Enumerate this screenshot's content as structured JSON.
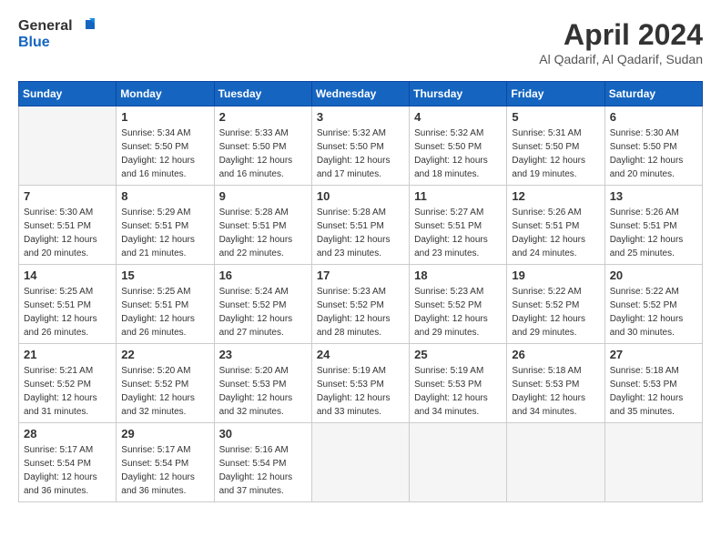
{
  "header": {
    "logo_general": "General",
    "logo_blue": "Blue",
    "title": "April 2024",
    "location": "Al Qadarif, Al Qadarif, Sudan"
  },
  "weekdays": [
    "Sunday",
    "Monday",
    "Tuesday",
    "Wednesday",
    "Thursday",
    "Friday",
    "Saturday"
  ],
  "weeks": [
    [
      {
        "day": null
      },
      {
        "day": "1",
        "sunrise": "5:34 AM",
        "sunset": "5:50 PM",
        "daylight": "12 hours and 16 minutes."
      },
      {
        "day": "2",
        "sunrise": "5:33 AM",
        "sunset": "5:50 PM",
        "daylight": "12 hours and 16 minutes."
      },
      {
        "day": "3",
        "sunrise": "5:32 AM",
        "sunset": "5:50 PM",
        "daylight": "12 hours and 17 minutes."
      },
      {
        "day": "4",
        "sunrise": "5:32 AM",
        "sunset": "5:50 PM",
        "daylight": "12 hours and 18 minutes."
      },
      {
        "day": "5",
        "sunrise": "5:31 AM",
        "sunset": "5:50 PM",
        "daylight": "12 hours and 19 minutes."
      },
      {
        "day": "6",
        "sunrise": "5:30 AM",
        "sunset": "5:50 PM",
        "daylight": "12 hours and 20 minutes."
      }
    ],
    [
      {
        "day": "7",
        "sunrise": "5:30 AM",
        "sunset": "5:51 PM",
        "daylight": "12 hours and 20 minutes."
      },
      {
        "day": "8",
        "sunrise": "5:29 AM",
        "sunset": "5:51 PM",
        "daylight": "12 hours and 21 minutes."
      },
      {
        "day": "9",
        "sunrise": "5:28 AM",
        "sunset": "5:51 PM",
        "daylight": "12 hours and 22 minutes."
      },
      {
        "day": "10",
        "sunrise": "5:28 AM",
        "sunset": "5:51 PM",
        "daylight": "12 hours and 23 minutes."
      },
      {
        "day": "11",
        "sunrise": "5:27 AM",
        "sunset": "5:51 PM",
        "daylight": "12 hours and 23 minutes."
      },
      {
        "day": "12",
        "sunrise": "5:26 AM",
        "sunset": "5:51 PM",
        "daylight": "12 hours and 24 minutes."
      },
      {
        "day": "13",
        "sunrise": "5:26 AM",
        "sunset": "5:51 PM",
        "daylight": "12 hours and 25 minutes."
      }
    ],
    [
      {
        "day": "14",
        "sunrise": "5:25 AM",
        "sunset": "5:51 PM",
        "daylight": "12 hours and 26 minutes."
      },
      {
        "day": "15",
        "sunrise": "5:25 AM",
        "sunset": "5:51 PM",
        "daylight": "12 hours and 26 minutes."
      },
      {
        "day": "16",
        "sunrise": "5:24 AM",
        "sunset": "5:52 PM",
        "daylight": "12 hours and 27 minutes."
      },
      {
        "day": "17",
        "sunrise": "5:23 AM",
        "sunset": "5:52 PM",
        "daylight": "12 hours and 28 minutes."
      },
      {
        "day": "18",
        "sunrise": "5:23 AM",
        "sunset": "5:52 PM",
        "daylight": "12 hours and 29 minutes."
      },
      {
        "day": "19",
        "sunrise": "5:22 AM",
        "sunset": "5:52 PM",
        "daylight": "12 hours and 29 minutes."
      },
      {
        "day": "20",
        "sunrise": "5:22 AM",
        "sunset": "5:52 PM",
        "daylight": "12 hours and 30 minutes."
      }
    ],
    [
      {
        "day": "21",
        "sunrise": "5:21 AM",
        "sunset": "5:52 PM",
        "daylight": "12 hours and 31 minutes."
      },
      {
        "day": "22",
        "sunrise": "5:20 AM",
        "sunset": "5:52 PM",
        "daylight": "12 hours and 32 minutes."
      },
      {
        "day": "23",
        "sunrise": "5:20 AM",
        "sunset": "5:53 PM",
        "daylight": "12 hours and 32 minutes."
      },
      {
        "day": "24",
        "sunrise": "5:19 AM",
        "sunset": "5:53 PM",
        "daylight": "12 hours and 33 minutes."
      },
      {
        "day": "25",
        "sunrise": "5:19 AM",
        "sunset": "5:53 PM",
        "daylight": "12 hours and 34 minutes."
      },
      {
        "day": "26",
        "sunrise": "5:18 AM",
        "sunset": "5:53 PM",
        "daylight": "12 hours and 34 minutes."
      },
      {
        "day": "27",
        "sunrise": "5:18 AM",
        "sunset": "5:53 PM",
        "daylight": "12 hours and 35 minutes."
      }
    ],
    [
      {
        "day": "28",
        "sunrise": "5:17 AM",
        "sunset": "5:54 PM",
        "daylight": "12 hours and 36 minutes."
      },
      {
        "day": "29",
        "sunrise": "5:17 AM",
        "sunset": "5:54 PM",
        "daylight": "12 hours and 36 minutes."
      },
      {
        "day": "30",
        "sunrise": "5:16 AM",
        "sunset": "5:54 PM",
        "daylight": "12 hours and 37 minutes."
      },
      {
        "day": null
      },
      {
        "day": null
      },
      {
        "day": null
      },
      {
        "day": null
      }
    ]
  ]
}
